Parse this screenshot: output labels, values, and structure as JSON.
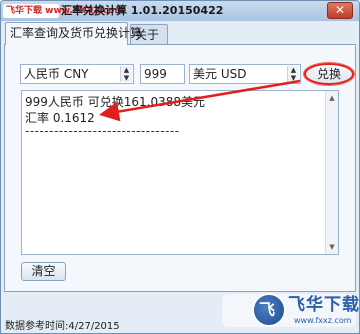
{
  "window": {
    "logo_text": "飞华下载 www.FXXZ.com",
    "title": "汇率兑换计算 1.01.20150422",
    "close_glyph": "✕"
  },
  "tabs": [
    {
      "label": "汇率查询及货币兑换计算",
      "active": true
    },
    {
      "label": "关于",
      "active": false
    }
  ],
  "converter": {
    "from_currency": "人民币 CNY",
    "amount": "999",
    "to_currency": "美元 USD",
    "convert_label": "兑换"
  },
  "output": {
    "line1": "999人民币 可兑换161.0388美元",
    "line2": "汇率 0.1612",
    "separator": "--------------------------------"
  },
  "clear_label": "清空",
  "status": {
    "text": "数据参考时间:4/27/2015"
  },
  "watermark": {
    "title": "飞华下载",
    "sub": "www.fxxz.com"
  },
  "annotation": {
    "arrow_color": "#e0201a",
    "highlight_color": "#e0201a"
  }
}
